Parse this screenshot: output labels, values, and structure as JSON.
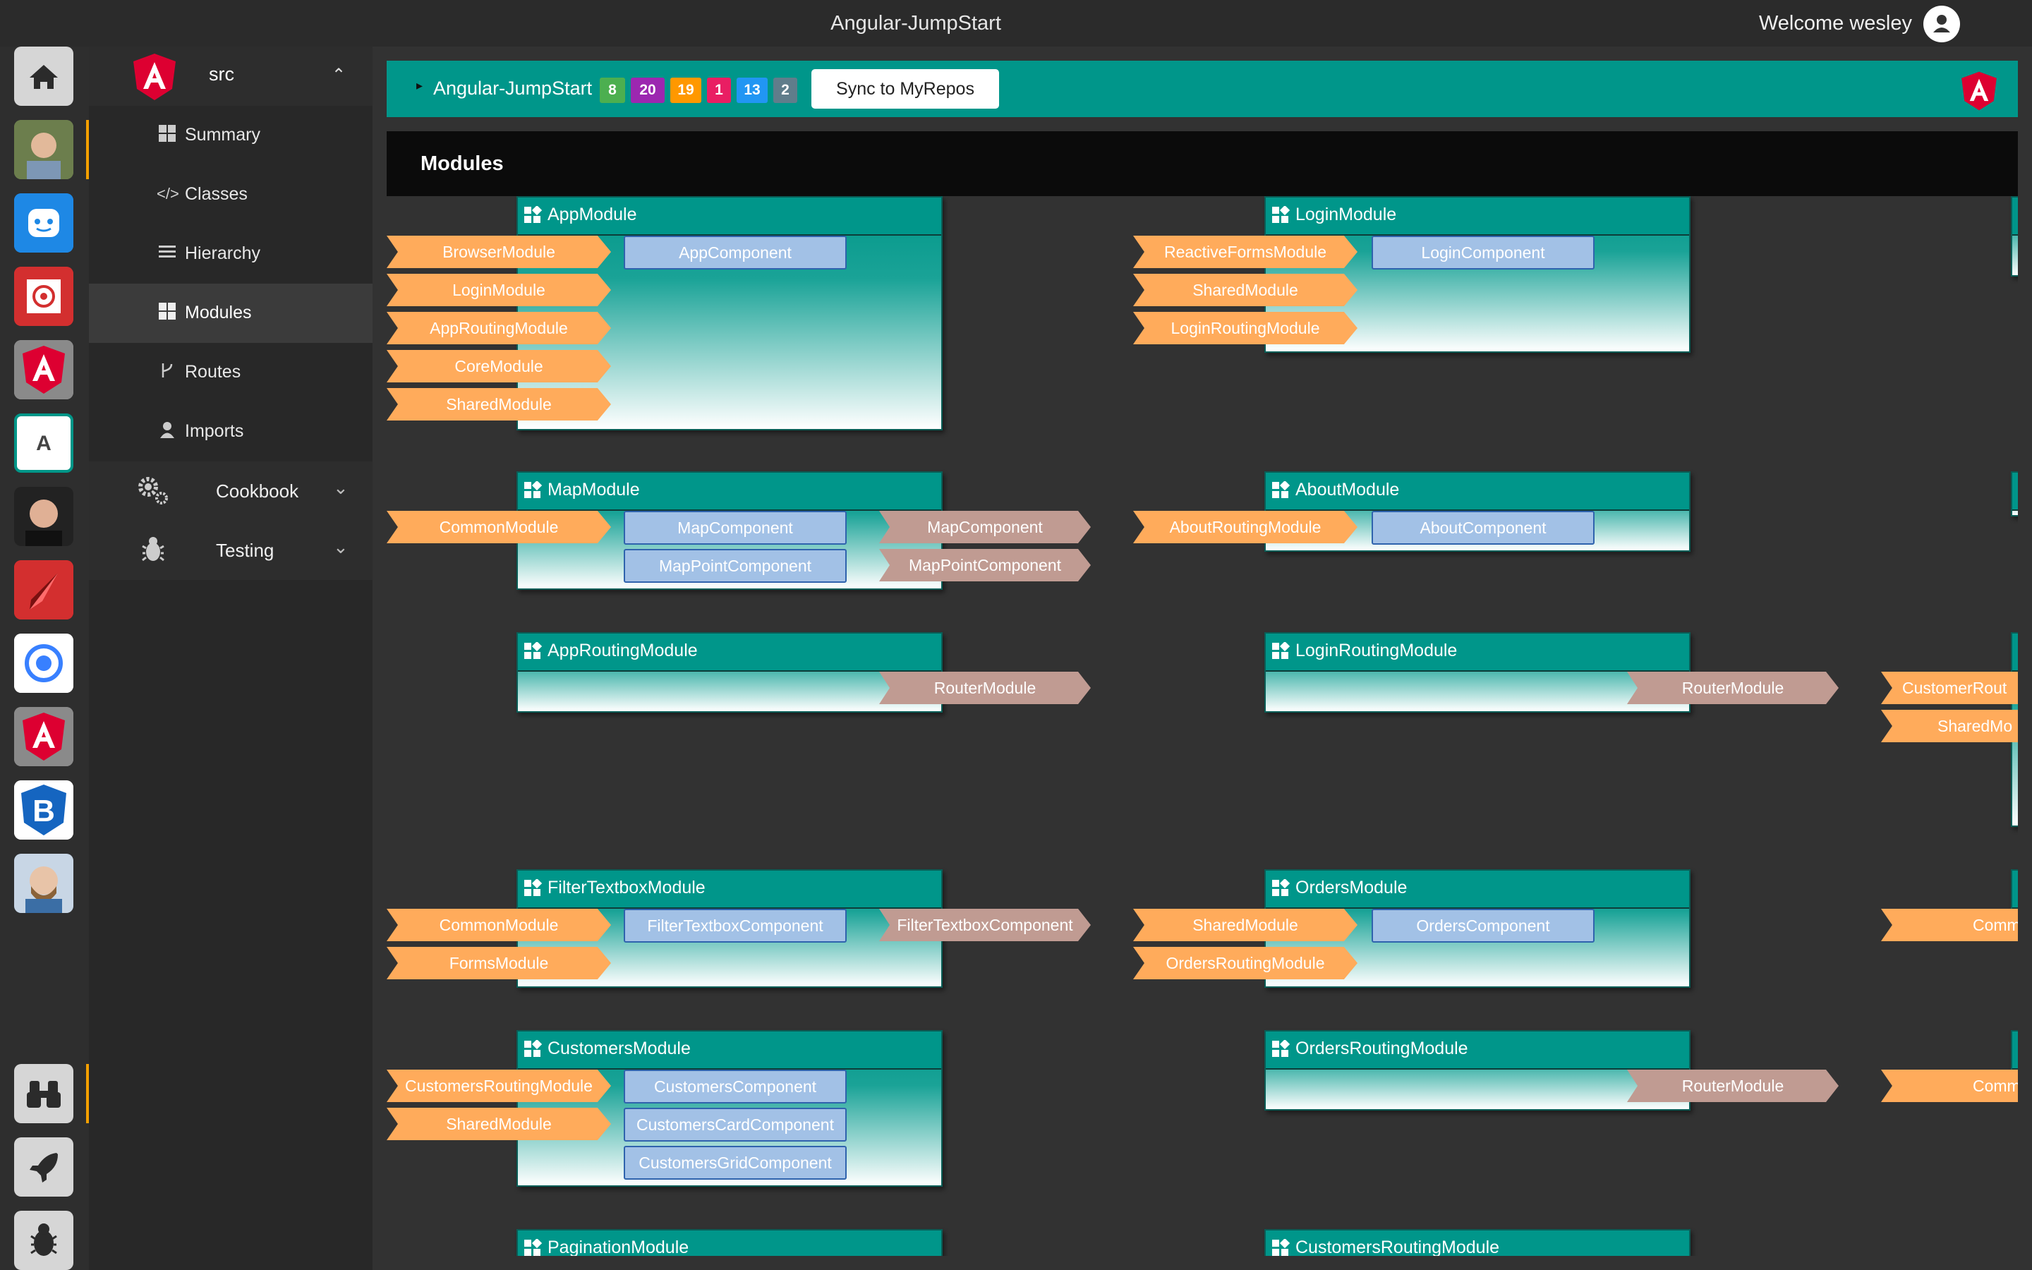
{
  "window": {
    "title": "Angular-JumpStart",
    "welcome": "Welcome wesley"
  },
  "sidebar": {
    "project": "src",
    "items": [
      {
        "label": "Summary",
        "icon": "grid-icon"
      },
      {
        "label": "Classes",
        "icon": "code-icon"
      },
      {
        "label": "Hierarchy",
        "icon": "list-icon"
      },
      {
        "label": "Modules",
        "icon": "grid-icon",
        "active": true
      },
      {
        "label": "Routes",
        "icon": "branch-icon"
      },
      {
        "label": "Imports",
        "icon": "person-icon"
      }
    ],
    "groups": [
      {
        "label": "Cookbook",
        "icon": "gears-icon"
      },
      {
        "label": "Testing",
        "icon": "bug-icon"
      }
    ]
  },
  "banner": {
    "repo": "Angular-JumpStart",
    "badges": [
      {
        "value": "8",
        "color": "#4caf50"
      },
      {
        "value": "20",
        "color": "#9c27b0"
      },
      {
        "value": "19",
        "color": "#ff9800"
      },
      {
        "value": "1",
        "color": "#e91e63"
      },
      {
        "value": "13",
        "color": "#2196f3"
      },
      {
        "value": "2",
        "color": "#607d8b"
      }
    ],
    "sync_label": "Sync to MyRepos"
  },
  "section_title": "Modules",
  "modules": [
    {
      "name": "AppModule",
      "imports": [
        "BrowserModule",
        "LoginModule",
        "AppRoutingModule",
        "CoreModule",
        "SharedModule"
      ],
      "declarations": [
        "AppComponent"
      ],
      "exports": []
    },
    {
      "name": "LoginModule",
      "imports": [
        "ReactiveFormsModule",
        "SharedModule",
        "LoginRoutingModule"
      ],
      "declarations": [
        "LoginComponent"
      ],
      "exports": []
    },
    {
      "name": "MapModule",
      "imports": [
        "CommonModule"
      ],
      "declarations": [
        "MapComponent",
        "MapPointComponent"
      ],
      "exports": [
        "MapComponent",
        "MapPointComponent"
      ]
    },
    {
      "name": "AboutModule",
      "imports": [
        "AboutRoutingModule"
      ],
      "declarations": [
        "AboutComponent"
      ],
      "exports": []
    },
    {
      "name": "AppRoutingModule",
      "imports": [],
      "declarations": [],
      "exports": [
        "RouterModule"
      ]
    },
    {
      "name": "LoginRoutingModule",
      "imports": [],
      "declarations": [],
      "exports": [
        "RouterModule"
      ]
    },
    {
      "name": "FilterTextboxModule",
      "imports": [
        "CommonModule",
        "FormsModule"
      ],
      "declarations": [
        "FilterTextboxComponent"
      ],
      "exports": [
        "FilterTextboxComponent"
      ]
    },
    {
      "name": "OrdersModule",
      "imports": [
        "SharedModule",
        "OrdersRoutingModule"
      ],
      "declarations": [
        "OrdersComponent"
      ],
      "exports": []
    },
    {
      "name": "CustomersModule",
      "imports": [
        "CustomersRoutingModule",
        "SharedModule"
      ],
      "declarations": [
        "CustomersComponent",
        "CustomersCardComponent",
        "CustomersGridComponent"
      ],
      "exports": []
    },
    {
      "name": "OrdersRoutingModule",
      "imports": [],
      "declarations": [],
      "exports": [
        "RouterModule"
      ]
    },
    {
      "name": "PaginationModule",
      "imports": [],
      "declarations": [],
      "exports": []
    },
    {
      "name": "CustomersRoutingModule",
      "imports": [],
      "declarations": [],
      "exports": []
    }
  ],
  "partial_right": [
    "CustomerRout",
    "SharedMo",
    "CommonM",
    "CommonM"
  ]
}
